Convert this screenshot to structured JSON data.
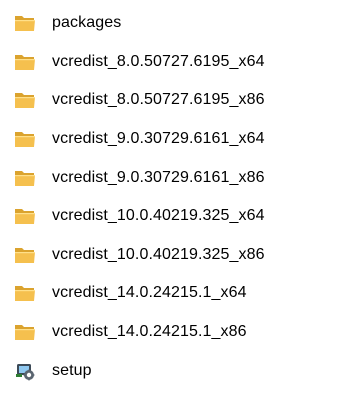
{
  "explorer": {
    "items": [
      {
        "name": "packages",
        "type": "folder",
        "icon": "folder-icon"
      },
      {
        "name": "vcredist_8.0.50727.6195_x64",
        "type": "folder",
        "icon": "folder-icon"
      },
      {
        "name": "vcredist_8.0.50727.6195_x86",
        "type": "folder",
        "icon": "folder-icon"
      },
      {
        "name": "vcredist_9.0.30729.6161_x64",
        "type": "folder",
        "icon": "folder-icon"
      },
      {
        "name": "vcredist_9.0.30729.6161_x86",
        "type": "folder",
        "icon": "folder-icon"
      },
      {
        "name": "vcredist_10.0.40219.325_x64",
        "type": "folder",
        "icon": "folder-icon"
      },
      {
        "name": "vcredist_10.0.40219.325_x86",
        "type": "folder",
        "icon": "folder-icon"
      },
      {
        "name": "vcredist_14.0.24215.1_x64",
        "type": "folder",
        "icon": "folder-icon"
      },
      {
        "name": "vcredist_14.0.24215.1_x86",
        "type": "folder",
        "icon": "folder-icon"
      },
      {
        "name": "setup",
        "type": "application",
        "icon": "setup-app-icon"
      }
    ]
  },
  "colors": {
    "folder_body": "#F5C04E",
    "folder_tab": "#DBA32E",
    "text": "#000000"
  }
}
